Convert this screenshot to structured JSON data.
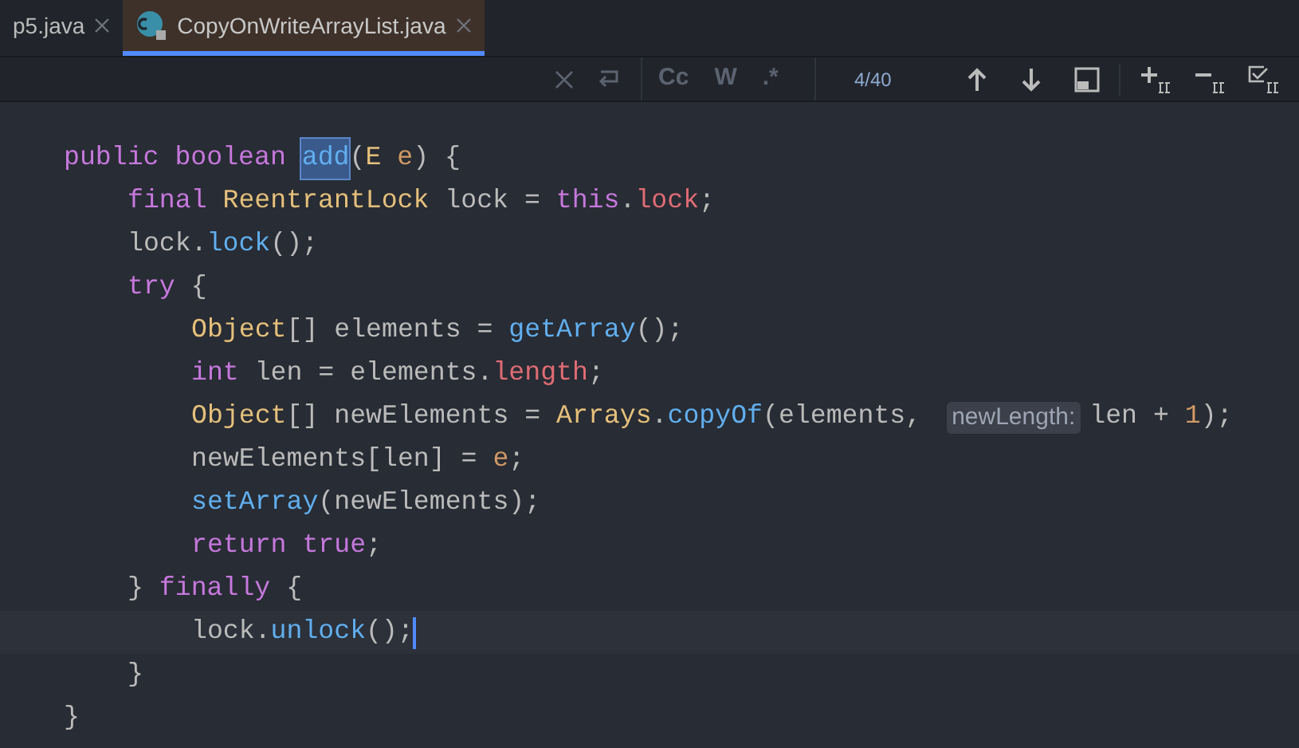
{
  "tabs": [
    {
      "label": "p5.java",
      "selected": false,
      "icon": false
    },
    {
      "label": "CopyOnWriteArrayList.java",
      "selected": true,
      "icon": true
    }
  ],
  "find_bar": {
    "options": [
      {
        "label": "Cc",
        "on": false
      },
      {
        "label": "W",
        "on": false
      },
      {
        "label": ".*",
        "on": false
      }
    ],
    "match_count": "4/40"
  },
  "editor": {
    "lines": [
      {
        "current": false,
        "tokens": [
          {
            "kind": "kw",
            "text": "public boolean "
          },
          {
            "kind": "match",
            "text": "add",
            "selected": true
          },
          {
            "kind": "plain",
            "text": "("
          },
          {
            "kind": "type",
            "text": "E "
          },
          {
            "kind": "param",
            "text": "e"
          },
          {
            "kind": "plain",
            "text": ") {"
          }
        ],
        "children": [
          {
            "current": false,
            "tokens": [
              {
                "kind": "kw",
                "text": "final "
              },
              {
                "kind": "type",
                "text": "ReentrantLock "
              },
              {
                "kind": "plain",
                "text": "lock = "
              },
              {
                "kind": "kw",
                "text": "this"
              },
              {
                "kind": "plain",
                "text": "."
              },
              {
                "kind": "field",
                "text": "lock"
              },
              {
                "kind": "plain",
                "text": ";"
              }
            ]
          },
          {
            "current": false,
            "tokens": [
              {
                "kind": "plain",
                "text": "lock."
              },
              {
                "kind": "fn",
                "text": "lock"
              },
              {
                "kind": "plain",
                "text": "();"
              }
            ]
          },
          {
            "current": false,
            "tokens": [
              {
                "kind": "kw",
                "text": "try "
              },
              {
                "kind": "plain",
                "text": "{"
              }
            ],
            "children": [
              {
                "current": false,
                "tokens": [
                  {
                    "kind": "type",
                    "text": "Object"
                  },
                  {
                    "kind": "plain",
                    "text": "[] elements = "
                  },
                  {
                    "kind": "fn",
                    "text": "getArray"
                  },
                  {
                    "kind": "plain",
                    "text": "();"
                  }
                ]
              },
              {
                "current": false,
                "tokens": [
                  {
                    "kind": "kw",
                    "text": "int "
                  },
                  {
                    "kind": "plain",
                    "text": "len = elements."
                  },
                  {
                    "kind": "field",
                    "text": "length"
                  },
                  {
                    "kind": "plain",
                    "text": ";"
                  }
                ]
              },
              {
                "current": false,
                "tokens": [
                  {
                    "kind": "type",
                    "text": "Object"
                  },
                  {
                    "kind": "plain",
                    "text": "[] newElements = "
                  },
                  {
                    "kind": "type",
                    "text": "Arrays"
                  },
                  {
                    "kind": "plain",
                    "text": "."
                  },
                  {
                    "kind": "fn",
                    "text": "copyOf"
                  },
                  {
                    "kind": "plain",
                    "text": "(elements, "
                  },
                  {
                    "kind": "hint",
                    "text": "newLength:"
                  },
                  {
                    "kind": "plain",
                    "text": "len + "
                  },
                  {
                    "kind": "num",
                    "text": "1"
                  },
                  {
                    "kind": "plain",
                    "text": ");"
                  }
                ]
              },
              {
                "current": false,
                "tokens": [
                  {
                    "kind": "plain",
                    "text": "newElements[len] = "
                  },
                  {
                    "kind": "param",
                    "text": "e"
                  },
                  {
                    "kind": "plain",
                    "text": ";"
                  }
                ]
              },
              {
                "current": false,
                "tokens": [
                  {
                    "kind": "fn",
                    "text": "setArray"
                  },
                  {
                    "kind": "plain",
                    "text": "(newElements);"
                  }
                ]
              },
              {
                "current": false,
                "tokens": [
                  {
                    "kind": "kw",
                    "text": "return true"
                  },
                  {
                    "kind": "plain",
                    "text": ";"
                  }
                ]
              }
            ]
          },
          {
            "current": false,
            "tokens": [
              {
                "kind": "plain",
                "text": "} "
              },
              {
                "kind": "kw",
                "text": "finally "
              },
              {
                "kind": "plain",
                "text": "{"
              }
            ],
            "children": [
              {
                "current": true,
                "tokens": [
                  {
                    "kind": "plain",
                    "text": "lock."
                  },
                  {
                    "kind": "fn",
                    "text": "unlock"
                  },
                  {
                    "kind": "plain",
                    "text": "();"
                  }
                ]
              }
            ]
          },
          {
            "current": false,
            "tokens": [
              {
                "kind": "plain",
                "text": "}"
              }
            ]
          }
        ]
      },
      {
        "current": false,
        "tokens": [
          {
            "kind": "plain",
            "text": "}"
          }
        ]
      }
    ]
  }
}
